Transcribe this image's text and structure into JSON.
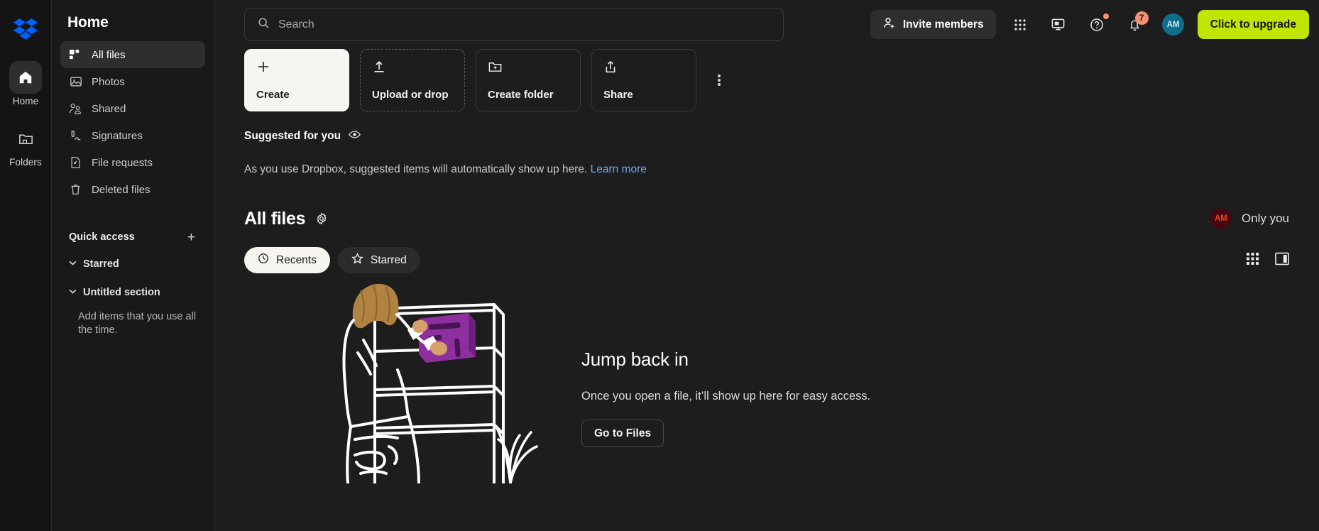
{
  "rail": {
    "logo_icon": "dropbox-logo",
    "items": [
      {
        "label": "Home",
        "icon": "home-icon",
        "active": true
      },
      {
        "label": "Folders",
        "icon": "folder-icon",
        "active": false
      }
    ]
  },
  "sidebar": {
    "title": "Home",
    "items": [
      {
        "label": "All files",
        "icon": "all-files-icon"
      },
      {
        "label": "Photos",
        "icon": "photos-icon"
      },
      {
        "label": "Shared",
        "icon": "shared-icon"
      },
      {
        "label": "Signatures",
        "icon": "signatures-icon"
      },
      {
        "label": "File requests",
        "icon": "file-requests-icon"
      },
      {
        "label": "Deleted files",
        "icon": "trash-icon"
      }
    ],
    "quick_access": {
      "label": "Quick access",
      "add_icon": "plus-icon"
    },
    "sections": [
      {
        "label": "Starred"
      },
      {
        "label": "Untitled section"
      }
    ],
    "hint": "Add items that you use all the time."
  },
  "topbar": {
    "search_placeholder": "Search",
    "search_icon": "search-icon",
    "invite_label": "Invite members",
    "invite_icon": "person-add-icon",
    "apps_icon": "grid-apps-icon",
    "desktop_icon": "desktop-icon",
    "help_icon": "question-circle-icon",
    "bell_icon": "bell-icon",
    "notification_count": "7",
    "avatar_initials": "AM",
    "upgrade_label": "Click to upgrade"
  },
  "actions": {
    "cards": [
      {
        "label": "Create",
        "icon": "plus-icon",
        "style": "light"
      },
      {
        "label": "Upload or drop",
        "icon": "upload-icon",
        "style": "dashed"
      },
      {
        "label": "Create folder",
        "icon": "folder-plus-icon",
        "style": "solid"
      },
      {
        "label": "Share",
        "icon": "share-icon",
        "style": "solid"
      }
    ],
    "overflow_icon": "kebab-menu-icon"
  },
  "suggested": {
    "title": "Suggested for you",
    "eye_icon": "eye-icon",
    "body": "As you use Dropbox, suggested items will automatically show up here.",
    "link": "Learn more"
  },
  "all_files": {
    "title": "All files",
    "gear_icon": "gear-icon",
    "sharing": {
      "avatar_initials": "AM",
      "label": "Only you"
    },
    "tabs": [
      {
        "label": "Recents",
        "icon": "clock-icon",
        "active": true
      },
      {
        "label": "Starred",
        "icon": "star-icon",
        "active": false
      }
    ],
    "view_grid_icon": "grid-view-icon",
    "view_split_icon": "split-view-icon"
  },
  "empty_state": {
    "illustration": "person-shelving-book-illustration",
    "title": "Jump back in",
    "body": "Once you open a file, it’ll show up here for easy access.",
    "button": "Go to Files"
  },
  "colors": {
    "brand_blue": "#0061fe",
    "upgrade_green": "#c1e500",
    "badge_peach": "#f88f72",
    "link_blue": "#6ba9f5",
    "avatar_teal": "#0f6e8c",
    "avatar_dark_red": "#450711",
    "avatar_red_text": "#f04124",
    "book_purple": "#8e2f9e"
  }
}
